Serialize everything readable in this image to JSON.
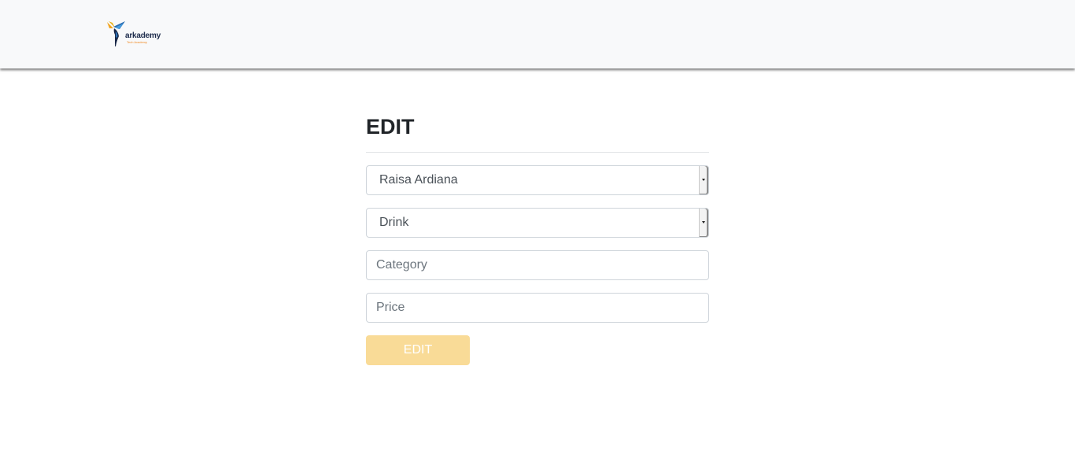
{
  "brand": {
    "name": "arkademy",
    "tagline": "Tech Academy",
    "colors": {
      "navy": "#1b2a4a",
      "orange": "#f08a24",
      "blue": "#1e88e5"
    }
  },
  "form": {
    "title": "EDIT",
    "cashier_select": {
      "selected": "Raisa Ardiana"
    },
    "product_select": {
      "selected": "Drink"
    },
    "category_input": {
      "placeholder": "Category",
      "value": ""
    },
    "price_input": {
      "placeholder": "Price",
      "value": ""
    },
    "submit_label": "EDIT"
  },
  "colors": {
    "navbar_bg": "#f8f9fa",
    "button_bg": "#f9db97",
    "input_border": "#ced4da"
  }
}
